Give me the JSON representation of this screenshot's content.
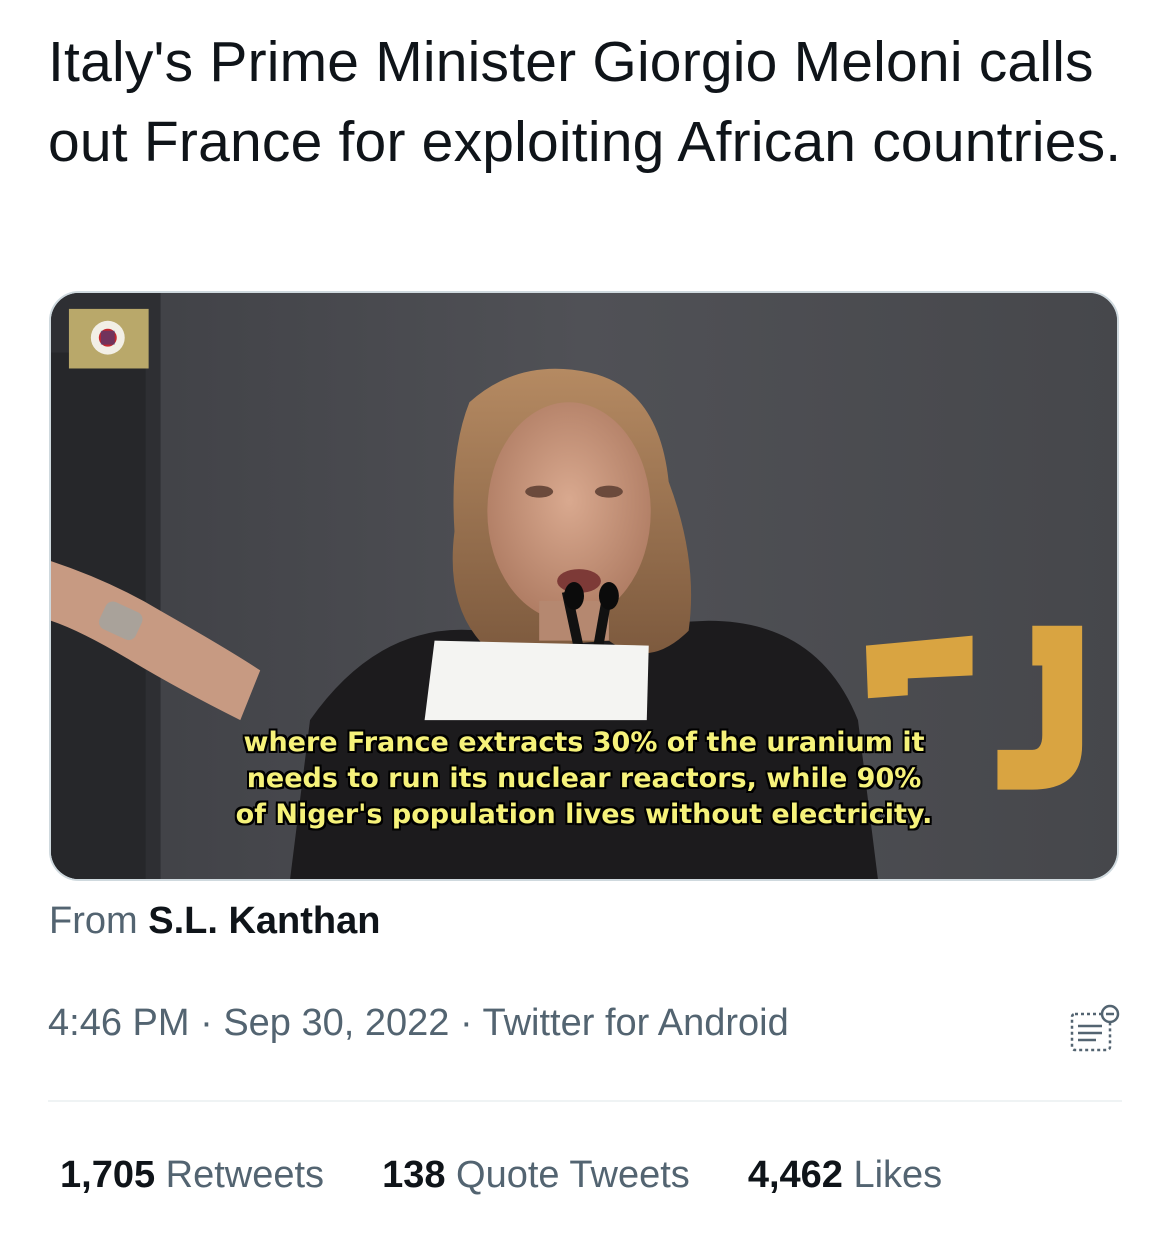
{
  "tweet": {
    "text": "Italy's Prime Minister Giorgio Meloni calls out France for exploiting African countries."
  },
  "media": {
    "stage_lettering": "EJ",
    "subtitles": [
      "where France extracts 30% of the uranium it",
      "needs to run its nuclear reactors, while 90%",
      "of Niger's population lives without electricity."
    ]
  },
  "source": {
    "prefix": "From",
    "name": "S.L. Kanthan"
  },
  "meta": {
    "time": "4:46 PM",
    "sep1": "·",
    "date": "Sep 30, 2022",
    "sep2": "·",
    "client": "Twitter for Android",
    "analytics_icon": "analytics-icon"
  },
  "stats": {
    "retweets_count": "1,705",
    "retweets_label": "Retweets",
    "quotes_count": "138",
    "quotes_label": "Quote Tweets",
    "likes_count": "4,462",
    "likes_label": "Likes"
  },
  "colors": {
    "text_primary": "#0f1419",
    "text_secondary": "#536471",
    "subtitle_yellow": "#f6f27a",
    "stage_orange": "#d9a441",
    "border": "#cfd9de"
  }
}
